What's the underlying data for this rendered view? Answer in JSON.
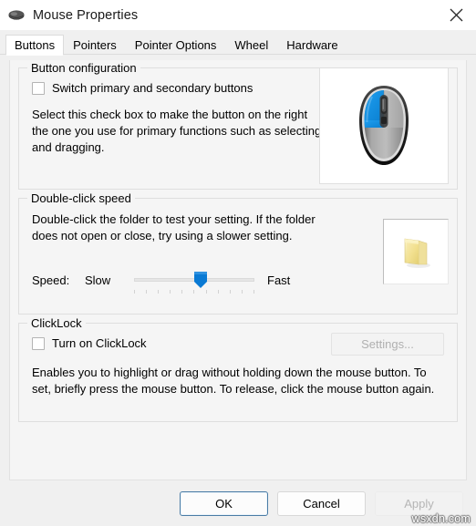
{
  "window": {
    "title": "Mouse Properties",
    "icon": "mouse-icon",
    "close_icon": "close-icon"
  },
  "tabs": [
    {
      "label": "Buttons",
      "active": true
    },
    {
      "label": "Pointers",
      "active": false
    },
    {
      "label": "Pointer Options",
      "active": false
    },
    {
      "label": "Wheel",
      "active": false
    },
    {
      "label": "Hardware",
      "active": false
    }
  ],
  "button_configuration": {
    "title": "Button configuration",
    "checkbox_label": "Switch primary and secondary buttons",
    "checkbox_checked": false,
    "description": "Select this check box to make the button on the right the one you use for primary functions such as selecting and dragging.",
    "preview_icon": "mouse-preview-icon",
    "preview_highlight_color": "#1a9bea"
  },
  "double_click_speed": {
    "title": "Double-click speed",
    "description": "Double-click the folder to test your setting. If the folder does not open or close, try using a slower setting.",
    "speed_label": "Speed:",
    "slow_label": "Slow",
    "fast_label": "Fast",
    "slider_value": 55,
    "slider_min": 0,
    "slider_max": 100,
    "slider_thumb_color": "#0a7ad4",
    "test_icon": "folder-icon"
  },
  "clicklock": {
    "title": "ClickLock",
    "checkbox_label": "Turn on ClickLock",
    "checkbox_checked": false,
    "settings_label": "Settings...",
    "settings_enabled": false,
    "description": "Enables you to highlight or drag without holding down the mouse button. To set, briefly press the mouse button. To release, click the mouse button again."
  },
  "footer": {
    "ok_label": "OK",
    "cancel_label": "Cancel",
    "apply_label": "Apply",
    "apply_enabled": false
  },
  "watermark": "wsxdn.com"
}
